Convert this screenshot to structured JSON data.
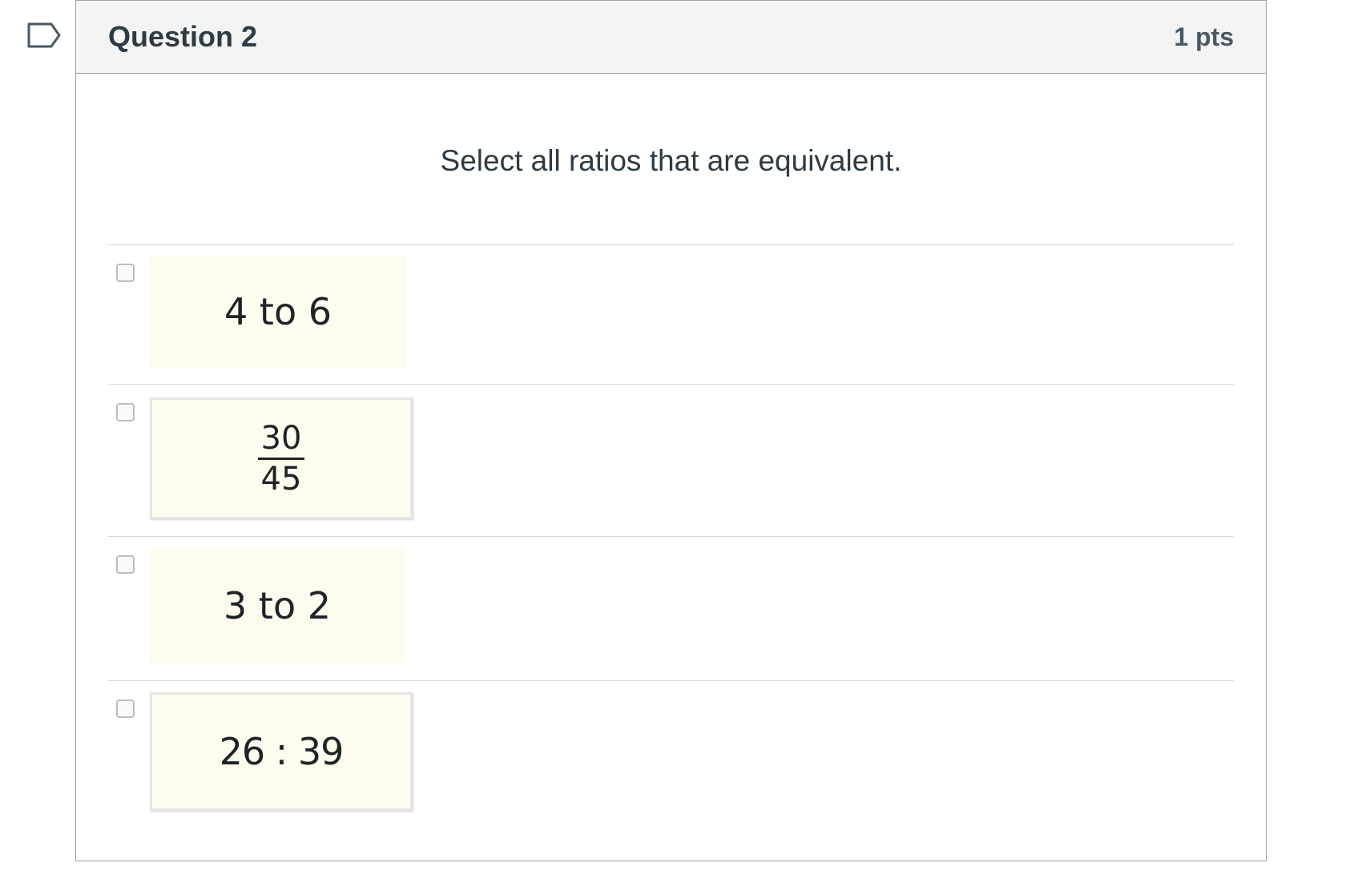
{
  "question": {
    "title": "Question 2",
    "points": "1 pts",
    "prompt": "Select all ratios that are equivalent."
  },
  "answers": [
    {
      "label": "4 to 6",
      "checked": false
    },
    {
      "numerator": "30",
      "denominator": "45",
      "checked": false
    },
    {
      "label": "3 to 2",
      "checked": false
    },
    {
      "label": "26 : 39",
      "checked": false
    }
  ],
  "icons": {
    "flag": "flag-icon"
  },
  "colors": {
    "header_bg": "#f4f4f5",
    "tile_bg": "#fdfcee",
    "border": "#9aa0a6",
    "text": "#2d3b45"
  }
}
